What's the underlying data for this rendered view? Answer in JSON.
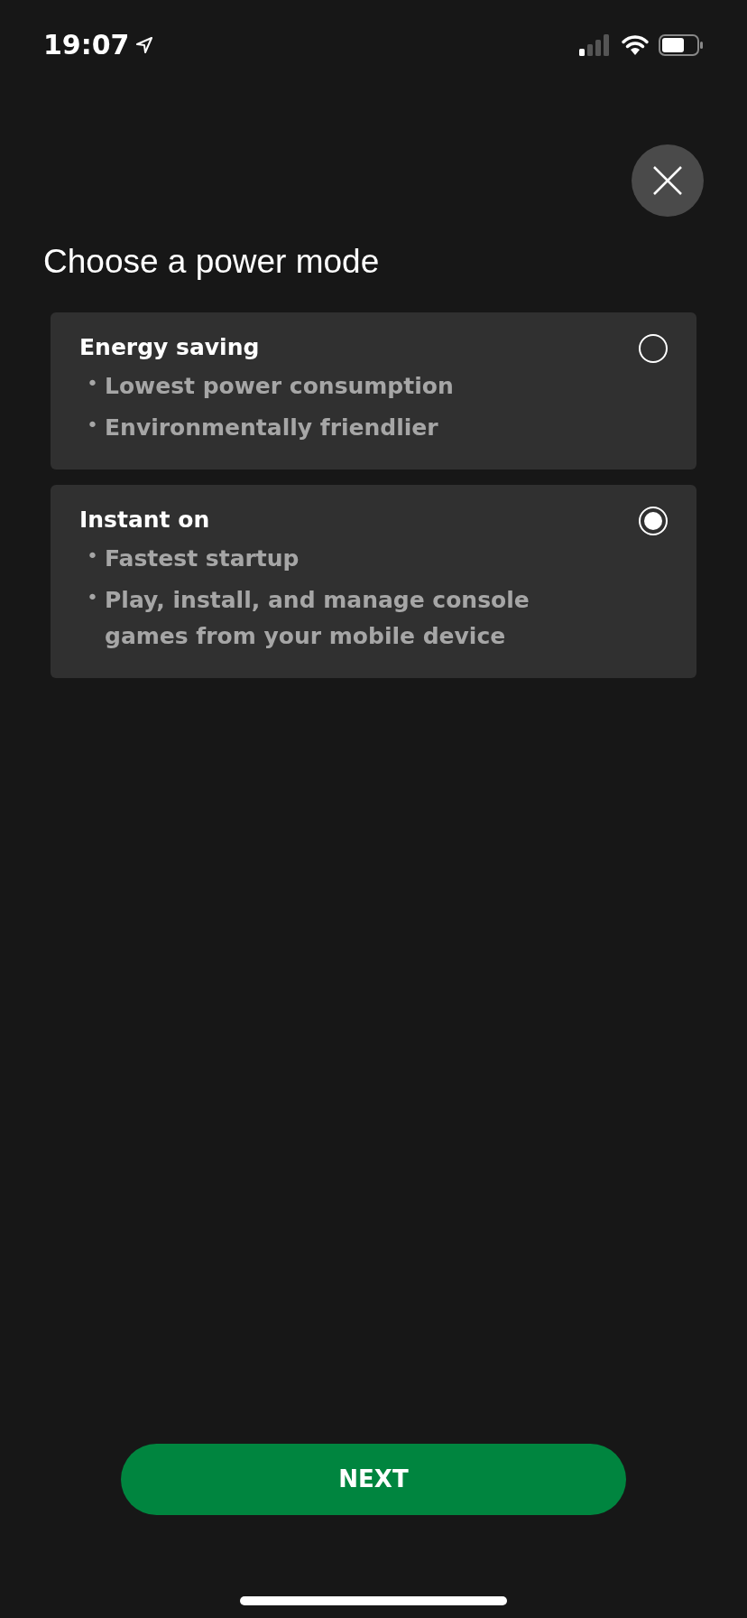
{
  "status_bar": {
    "time": "19:07"
  },
  "title": "Choose a power mode",
  "options": [
    {
      "title": "Energy saving",
      "bullets": [
        "Lowest power consumption",
        "Environmentally friendlier"
      ],
      "selected": false
    },
    {
      "title": "Instant on",
      "bullets": [
        "Fastest startup",
        "Play, install, and manage console games from your mobile device"
      ],
      "selected": true
    }
  ],
  "bullet_mark": "•",
  "next_button": {
    "label": "NEXT"
  }
}
